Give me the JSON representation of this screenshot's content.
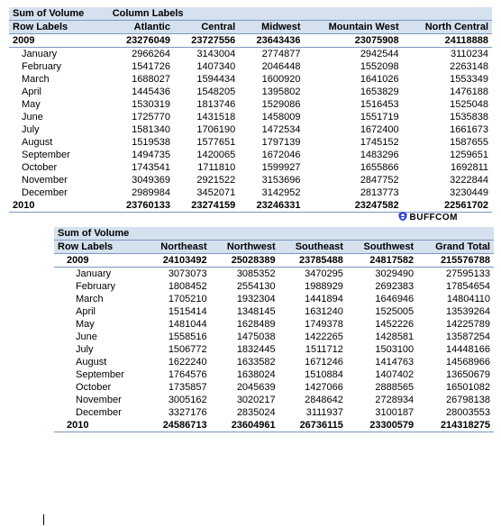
{
  "labels": {
    "sum_of_volume": "Sum of Volume",
    "column_labels": "Column Labels",
    "row_labels": "Row Labels"
  },
  "brand": "BUFFCOM",
  "table1": {
    "cols": [
      "Atlantic",
      "Central",
      "Midwest",
      "Mountain West",
      "North Central"
    ],
    "y2009": [
      "23276049",
      "23727556",
      "23643436",
      "23075908",
      "24118888"
    ],
    "rows": [
      {
        "m": "January",
        "v": [
          "2966264",
          "3143004",
          "2774877",
          "2942544",
          "3110234"
        ]
      },
      {
        "m": "February",
        "v": [
          "1541726",
          "1407340",
          "2046448",
          "1552098",
          "2263148"
        ]
      },
      {
        "m": "March",
        "v": [
          "1688027",
          "1594434",
          "1600920",
          "1641026",
          "1553349"
        ]
      },
      {
        "m": "April",
        "v": [
          "1445436",
          "1548205",
          "1395802",
          "1653829",
          "1476188"
        ]
      },
      {
        "m": "May",
        "v": [
          "1530319",
          "1813746",
          "1529086",
          "1516453",
          "1525048"
        ]
      },
      {
        "m": "June",
        "v": [
          "1725770",
          "1431518",
          "1458009",
          "1551719",
          "1535838"
        ]
      },
      {
        "m": "July",
        "v": [
          "1581340",
          "1706190",
          "1472534",
          "1672400",
          "1661673"
        ]
      },
      {
        "m": "August",
        "v": [
          "1519538",
          "1577651",
          "1797139",
          "1745152",
          "1587655"
        ]
      },
      {
        "m": "September",
        "v": [
          "1494735",
          "1420065",
          "1672046",
          "1483296",
          "1259651"
        ]
      },
      {
        "m": "October",
        "v": [
          "1743541",
          "1711810",
          "1599927",
          "1655866",
          "1692811"
        ]
      },
      {
        "m": "November",
        "v": [
          "3049369",
          "2921522",
          "3153696",
          "2847752",
          "3222844"
        ]
      },
      {
        "m": "December",
        "v": [
          "2989984",
          "3452071",
          "3142952",
          "2813773",
          "3230449"
        ]
      }
    ],
    "y2010": [
      "23760133",
      "23274159",
      "23246331",
      "23247582",
      "22561702"
    ]
  },
  "table2": {
    "cols": [
      "Northeast",
      "Northwest",
      "Southeast",
      "Southwest",
      "Grand Total"
    ],
    "y2009": [
      "24103492",
      "25028389",
      "23785488",
      "24817582",
      "215576788"
    ],
    "rows": [
      {
        "m": "January",
        "v": [
          "3073073",
          "3085352",
          "3470295",
          "3029490",
          "27595133"
        ]
      },
      {
        "m": "February",
        "v": [
          "1808452",
          "2554130",
          "1988929",
          "2692383",
          "17854654"
        ]
      },
      {
        "m": "March",
        "v": [
          "1705210",
          "1932304",
          "1441894",
          "1646946",
          "14804110"
        ]
      },
      {
        "m": "April",
        "v": [
          "1515414",
          "1348145",
          "1631240",
          "1525005",
          "13539264"
        ]
      },
      {
        "m": "May",
        "v": [
          "1481044",
          "1628489",
          "1749378",
          "1452226",
          "14225789"
        ]
      },
      {
        "m": "June",
        "v": [
          "1558516",
          "1475038",
          "1422265",
          "1428581",
          "13587254"
        ]
      },
      {
        "m": "July",
        "v": [
          "1506772",
          "1832445",
          "1511712",
          "1503100",
          "14448166"
        ]
      },
      {
        "m": "August",
        "v": [
          "1622240",
          "1633582",
          "1671246",
          "1414763",
          "14568966"
        ]
      },
      {
        "m": "September",
        "v": [
          "1764576",
          "1638024",
          "1510884",
          "1407402",
          "13650679"
        ]
      },
      {
        "m": "October",
        "v": [
          "1735857",
          "2045639",
          "1427066",
          "2888565",
          "16501082"
        ]
      },
      {
        "m": "November",
        "v": [
          "3005162",
          "3020217",
          "2848642",
          "2728934",
          "26798138"
        ]
      },
      {
        "m": "December",
        "v": [
          "3327176",
          "2835024",
          "3111937",
          "3100187",
          "28003553"
        ]
      }
    ],
    "y2010": [
      "24586713",
      "23604961",
      "26736115",
      "23300579",
      "214318275"
    ]
  }
}
